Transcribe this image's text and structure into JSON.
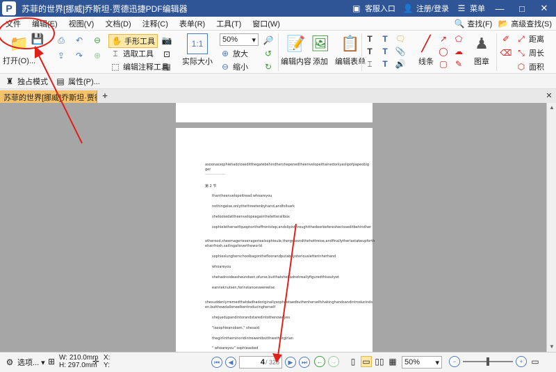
{
  "window": {
    "title": "苏菲的世界[挪威]乔斯坦·贾德迅捷PDF编辑器",
    "logo": "P",
    "customer_service": "客服入口",
    "login": "注册/登录",
    "menu": "菜单",
    "minimize": "—",
    "maximize": "□",
    "close": "✕"
  },
  "menubar": {
    "items": [
      "文件",
      "编辑(E)",
      "视图(V)",
      "文档(D)",
      "注释(C)",
      "表单(R)",
      "工具(T)",
      "窗口(W)"
    ],
    "find": "查找(F)",
    "advanced_find": "高级查找(S)"
  },
  "ribbon": {
    "open": "打开(O)...",
    "hand_tool": "手形工具",
    "select_tool": "选取工具",
    "edit_annotation_tool": "编辑注释工具",
    "actual_size": "实际大小",
    "actual_size_icon": "1:1",
    "zoom_value": "50%",
    "zoom_in": "放大",
    "zoom_out": "缩小",
    "edit_content": "编辑内容",
    "add": "添加",
    "edit_form": "编辑表单",
    "line": "线条",
    "stamp": "图章",
    "distance": "距离",
    "perimeter": "周长",
    "area": "面积"
  },
  "subbar": {
    "exclusive_mode": "独占模式",
    "properties": "属性(P)..."
  },
  "tab": {
    "label": "苏菲的世界[挪威]乔斯坦·贾德 *",
    "close": "✕",
    "add": "+"
  },
  "document": {
    "lines": [
      "asoonassophiehadcloseditthegatebehindhershepenedtheenvelopeittainedonlyaslipofpapeobig",
      "ger",
      "——————",
      "第 2 节",
      "thantheenvelopeitread:whoareyou",
      "nothingelse,onlythethreetenbyhand,andfollsark",
      "shelookedattheenvelopeagaintheletterallbox",
      "sophielethersetfquoptontheffrontstep,andslipinthroughtthedoorbeforeshecloseditbehindher",
      "otherood,sheemageriesenageriealsophieule,thergoiesndthehottreise,andfinallytherlastakeupforth",
      "ehairfrosh,sailingallovertheworld",
      "sophieslungherschoolbagonthefloorandputaboysteriousletterinherhand",
      "whoareyou",
      "shehadnoideasheundsen,ofurse,butthatshehadnotreallyfiguredthisoutyet",
      "eanneknutsen,forinstanceswereelse",
      "shesuddenlyrremedthatdadhadoriginallysophnetaedbuthenherselfshakinghandsandintroducinds",
      "en,butthewdalleneelkentroducingherself",
      "shejuedupandintorandstaredintothenoweyes",
      "\"iasophieanobam,\" shesaid",
      "thegirlintheminoridintrewentbutthwethergirlan",
      "\" whoareyou\" sophieasked"
    ]
  },
  "statusbar": {
    "options": "选项...",
    "width": "W: 210.0mm",
    "height": "H: 297.0mm",
    "x_label": "X:",
    "y_label": "Y:",
    "current_page": "4",
    "total_pages": "/ 328",
    "zoom": "50%"
  },
  "colors": {
    "title_bar": "#2f5597",
    "tab_active": "#f4c26a",
    "viewport_bg": "#a6a6a6",
    "annotation_red": "#e0201b"
  }
}
